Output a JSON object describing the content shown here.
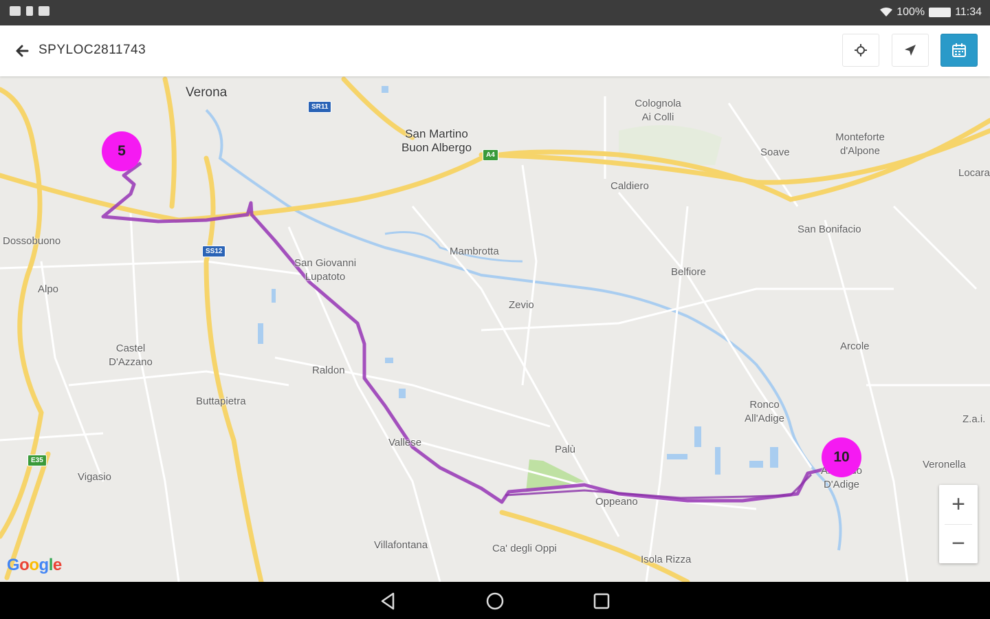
{
  "statusbar": {
    "battery": "100%",
    "time": "11:34"
  },
  "appbar": {
    "title": "SPYLOC2811743",
    "buttons": [
      "locate-icon",
      "navigation-icon",
      "calendar-icon"
    ],
    "accent": "#2a9ac9"
  },
  "map": {
    "places": {
      "verona": "Verona",
      "san_martino": "San Martino\nBuon Albergo",
      "colognola": "Colognola\nAi Colli",
      "soave": "Soave",
      "monteforte": "Monteforte\nd'Alpone",
      "locara": "Locara",
      "caldiero": "Caldiero",
      "san_bonifacio": "San Bonifacio",
      "dossobuono": "Dossobuono",
      "mambrotta": "Mambrotta",
      "san_giovanni": "San Giovanni\nLupatoto",
      "belfiore": "Belfiore",
      "alpo": "Alpo",
      "zevio": "Zevio",
      "castel": "Castel\nD'Azzano",
      "raldon": "Raldon",
      "arcole": "Arcole",
      "buttapietra": "Buttapietra",
      "ronco": "Ronco\nAll'Adige",
      "zai": "Z.a.i.",
      "vallese": "Vallese",
      "palu": "Palù",
      "veronella": "Veronella",
      "vigasio": "Vigasio",
      "oppeano": "Oppeano",
      "albaredo": "Albaredo\nD'Adige",
      "villafontana": "Villafontana",
      "ca_degli_oppi": "Ca' degli Oppi",
      "isola_rizza": "Isola Rizza"
    },
    "shields": {
      "sr11": "SR11",
      "ss12": "SS12",
      "a4": "A4",
      "e35": "E35"
    },
    "clusters": {
      "start": "5",
      "end": "10",
      "color": "#f51af2"
    },
    "route_color": "#9b3fb8",
    "zoom": {
      "in": "+",
      "out": "−"
    },
    "attribution": "Google"
  }
}
